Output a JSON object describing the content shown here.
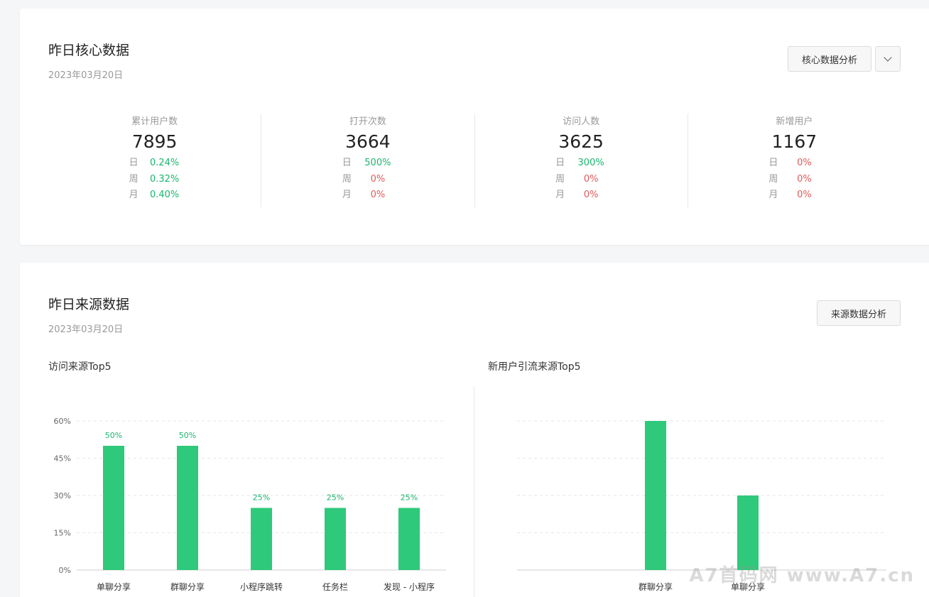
{
  "core": {
    "title": "昨日核心数据",
    "date": "2023年03月20日",
    "analysis_button": "核心数据分析",
    "metrics": [
      {
        "label": "累计用户数",
        "value": "7895",
        "rows": [
          {
            "k": "日",
            "v": "0.24%",
            "trend": "up"
          },
          {
            "k": "周",
            "v": "0.32%",
            "trend": "up"
          },
          {
            "k": "月",
            "v": "0.40%",
            "trend": "up"
          }
        ]
      },
      {
        "label": "打开次数",
        "value": "3664",
        "rows": [
          {
            "k": "日",
            "v": "500%",
            "trend": "up"
          },
          {
            "k": "周",
            "v": "0%",
            "trend": "down"
          },
          {
            "k": "月",
            "v": "0%",
            "trend": "down"
          }
        ]
      },
      {
        "label": "访问人数",
        "value": "3625",
        "rows": [
          {
            "k": "日",
            "v": "300%",
            "trend": "up"
          },
          {
            "k": "周",
            "v": "0%",
            "trend": "down"
          },
          {
            "k": "月",
            "v": "0%",
            "trend": "down"
          }
        ]
      },
      {
        "label": "新增用户",
        "value": "1167",
        "rows": [
          {
            "k": "日",
            "v": "0%",
            "trend": "down"
          },
          {
            "k": "周",
            "v": "0%",
            "trend": "down"
          },
          {
            "k": "月",
            "v": "0%",
            "trend": "down"
          }
        ]
      }
    ]
  },
  "source": {
    "title": "昨日来源数据",
    "date": "2023年03月20日",
    "analysis_button": "来源数据分析",
    "left_chart_title": "访问来源Top5",
    "right_chart_title": "新用户引流来源Top5"
  },
  "colors": {
    "bar": "#2ec97a",
    "up": "#1ab66e",
    "down": "#e05b5b"
  },
  "watermark": "A7首码网 www.A7.cn",
  "chart_data": [
    {
      "type": "bar",
      "title": "访问来源Top5",
      "categories": [
        "单聊分享",
        "群聊分享",
        "小程序跳转",
        "任务栏",
        "发现 - 小程序"
      ],
      "values": [
        50,
        50,
        25,
        25,
        25
      ],
      "value_labels": [
        "50%",
        "50%",
        "25%",
        "25%",
        "25%"
      ],
      "yticks": [
        "0%",
        "15%",
        "30%",
        "45%",
        "60%"
      ],
      "ylim": [
        0,
        60
      ],
      "grid": true
    },
    {
      "type": "bar",
      "title": "新用户引流来源Top5",
      "categories": [
        "群聊分享",
        "单聊分享"
      ],
      "values": [
        60,
        30
      ],
      "ylim": [
        0,
        60
      ],
      "grid": true
    }
  ]
}
